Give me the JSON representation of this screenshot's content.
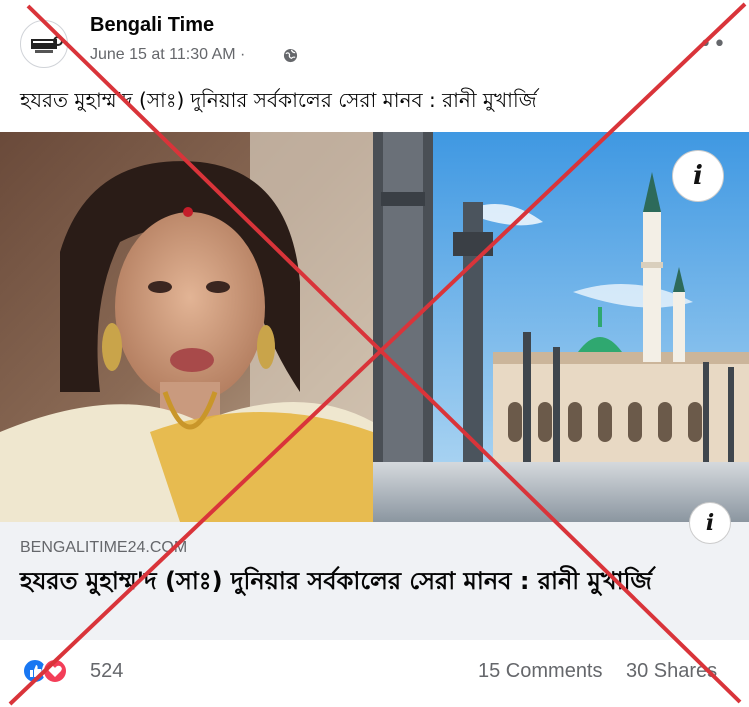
{
  "post": {
    "page_name": "Bengali Time",
    "timestamp": "June 15 at 11:30 AM",
    "separator": "·",
    "text": "হযরত মুহাম্ম'দ (সাঃ) দুনিয়ার সর্বকালের সেরা মানব : রানী মুখার্জি",
    "more_label": "••"
  },
  "link_preview": {
    "domain": "BENGALITIME24.COM",
    "title": "হযরত মুহাম্ম'দ (সাঃ) দুনিয়ার সর্বকালের সেরা মানব : রানী মুখার্জি",
    "info_label": "i"
  },
  "engagement": {
    "reaction_count": "524",
    "comments": "15 Comments",
    "shares": "30 Shares"
  },
  "colors": {
    "like": "#1877f2",
    "love": "#f33e58",
    "cross": "#d9343a",
    "link_box_bg": "#f0f2f5"
  }
}
